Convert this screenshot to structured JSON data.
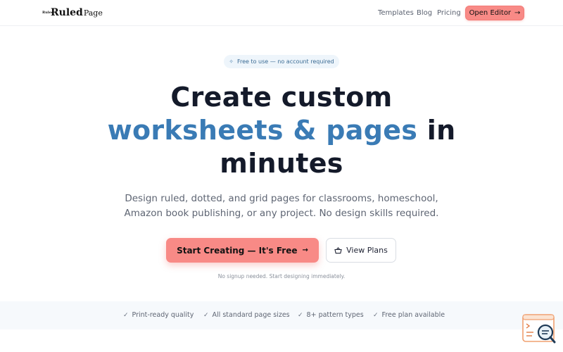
{
  "header": {
    "logo_mark": "Ruled",
    "logo_ruled": "Ruled",
    "logo_page": "Page",
    "nav": [
      "Templates",
      "Blog",
      "Pricing"
    ],
    "open_editor": "Open Editor"
  },
  "badge": {
    "text": "Free to use — no account required",
    "icon": "sparkle-icon"
  },
  "hero": {
    "line1": "Create custom",
    "line2_accent": "worksheets & pages",
    "line2_rest": " in",
    "line3": "minutes",
    "sub_line1": "Design ruled, dotted, and grid pages for classrooms, homeschool,",
    "sub_line2": "Amazon book publishing, or any project. No design skills required."
  },
  "cta": {
    "primary": "Start Creating — It's Free",
    "secondary": "View Plans",
    "note": "No signup needed. Start designing immediately."
  },
  "features": [
    "Print-ready quality",
    "All standard page sizes",
    "8+ pattern types",
    "Free plan available"
  ],
  "colors": {
    "accent": "#3a7bb5",
    "cta": "#f88a86",
    "text": "#141a2a"
  }
}
